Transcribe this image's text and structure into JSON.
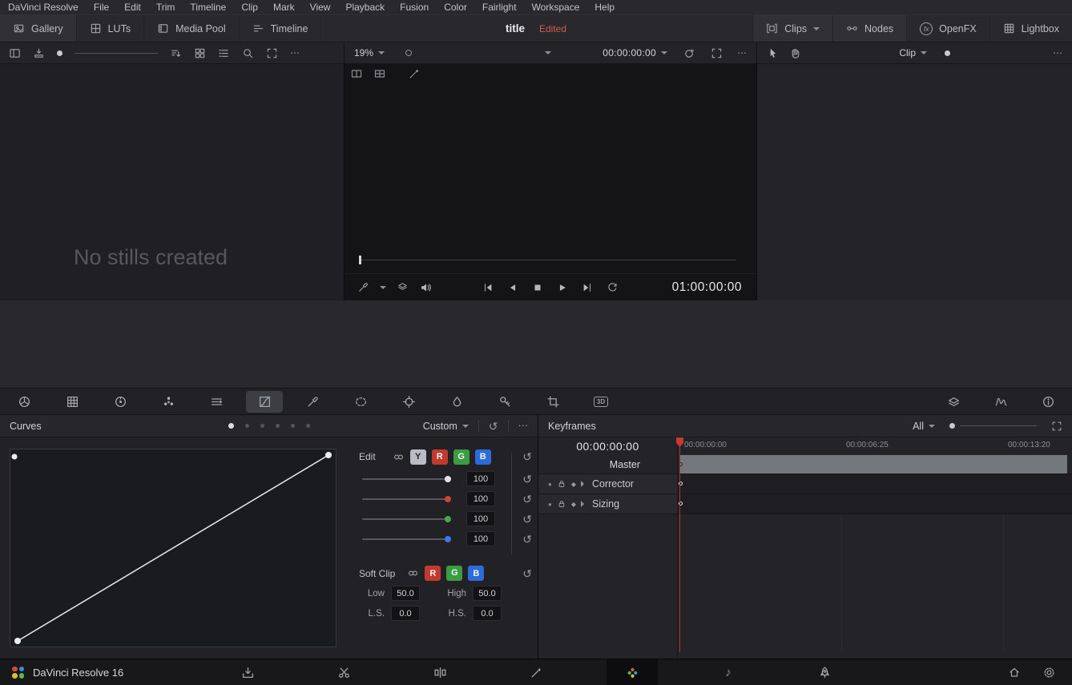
{
  "colors": {
    "accent_red": "#c73a2e",
    "status_red": "#d15a4a",
    "chip_red": "#c13a2f",
    "chip_green": "#3c9c43",
    "chip_blue": "#2d6bd8",
    "chip_luma": "#b9bcc4",
    "master_track_gray": "#74777c"
  },
  "menubar": {
    "items": [
      "DaVinci Resolve",
      "File",
      "Edit",
      "Trim",
      "Timeline",
      "Clip",
      "Mark",
      "View",
      "Playback",
      "Fusion",
      "Color",
      "Fairlight",
      "Workspace",
      "Help"
    ]
  },
  "topbar": {
    "gallery": "Gallery",
    "luts": "LUTs",
    "media_pool": "Media Pool",
    "timeline": "Timeline",
    "title": "title",
    "status": "Edited",
    "clips": "Clips",
    "nodes": "Nodes",
    "openfx": "OpenFX",
    "lightbox": "Lightbox"
  },
  "viewer_toolbar": {
    "zoom": "19%",
    "timecode": "00:00:00:00"
  },
  "nodes_toolbar": {
    "mode": "Clip"
  },
  "gallery": {
    "empty": "No stills created"
  },
  "viewer": {
    "timecode": "01:00:00:00"
  },
  "palette_icons": [
    "camera-raw",
    "color-match",
    "color-wheels",
    "rgb-mixer",
    "motion-effects",
    "curves",
    "qualifier",
    "power-window",
    "tracker",
    "blur",
    "key",
    "sizing",
    "stereo-3d"
  ],
  "curves": {
    "title": "Curves",
    "preset": "Custom",
    "edit": "Edit",
    "channels": [
      "Y",
      "R",
      "G",
      "B"
    ],
    "slider_values": [
      "100",
      "100",
      "100",
      "100"
    ],
    "soft_clip": "Soft Clip",
    "soft_channels": [
      "R",
      "G",
      "B"
    ],
    "low_label": "Low",
    "low": "50.0",
    "high_label": "High",
    "high": "50.0",
    "ls_label": "L.S.",
    "ls": "0.0",
    "hs_label": "H.S.",
    "hs": "0.0"
  },
  "keyframes": {
    "title": "Keyframes",
    "filter": "All",
    "timecode": "00:00:00:00",
    "ruler": [
      "00:00:00:00",
      "00:00:06:25",
      "00:00:13:20"
    ],
    "tracks": [
      "Master",
      "Corrector",
      "Sizing"
    ]
  },
  "statusbar": {
    "app": "DaVinci Resolve 16",
    "pages": [
      "media",
      "cut",
      "edit",
      "fusion",
      "color",
      "fairlight",
      "deliver"
    ]
  },
  "glyphs": {
    "more": "⋯",
    "reset": "↺",
    "diamond": "◆",
    "enable_dot": "●",
    "note": "♪",
    "fx": "fx",
    "threed": "3D"
  }
}
